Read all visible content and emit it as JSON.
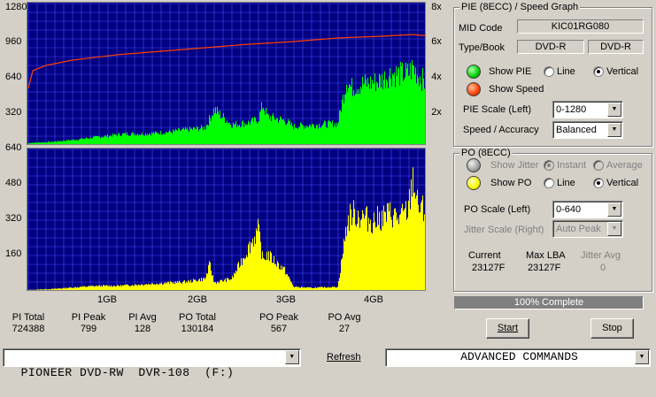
{
  "colors": {
    "graph_bg": "#000080",
    "grid": "#4a4aff",
    "pie": "#00ff00",
    "po": "#ffff00",
    "speed": "#ff4000",
    "cursor": "#ff4000",
    "progress": "#808080"
  },
  "pie_graph": {
    "left_ticks": [
      "1280",
      "960",
      "640",
      "320"
    ],
    "right_ticks": [
      "8x",
      "6x",
      "4x",
      "2x"
    ]
  },
  "po_graph": {
    "left_ticks": [
      "640",
      "480",
      "320",
      "160"
    ]
  },
  "x_axis_labels": [
    "1GB",
    "2GB",
    "3GB",
    "4GB"
  ],
  "chart_data": [
    {
      "type": "area",
      "title": "PIE (8ECC)",
      "x_unit": "GB",
      "xlim": [
        0,
        4.5
      ],
      "ylim": [
        0,
        1280
      ],
      "y2lim": [
        0,
        8
      ],
      "series": [
        {
          "name": "PIE",
          "x": [
            0.0,
            0.25,
            0.5,
            0.7,
            0.9,
            1.1,
            1.3,
            1.5,
            1.7,
            1.9,
            2.0,
            2.1,
            2.3,
            2.5,
            2.6,
            2.65,
            2.7,
            2.8,
            2.9,
            3.0,
            3.1,
            3.3,
            3.5,
            3.6,
            3.65,
            3.7,
            3.8,
            3.9,
            4.0,
            4.1,
            4.2,
            4.3,
            4.35,
            4.4,
            4.45,
            4.5
          ],
          "values": [
            20,
            30,
            50,
            70,
            90,
            110,
            110,
            120,
            140,
            160,
            170,
            350,
            200,
            220,
            250,
            400,
            280,
            260,
            240,
            180,
            190,
            200,
            210,
            640,
            560,
            580,
            600,
            610,
            640,
            700,
            690,
            700,
            760,
            700,
            650,
            580
          ]
        },
        {
          "name": "Speed",
          "x": [
            0.0,
            0.05,
            0.2,
            0.5,
            1.0,
            1.5,
            2.0,
            2.5,
            3.0,
            3.5,
            4.0,
            4.35,
            4.45,
            4.5
          ],
          "values": [
            3.2,
            4.2,
            4.5,
            4.8,
            5.1,
            5.3,
            5.5,
            5.7,
            5.85,
            6.05,
            6.15,
            6.25,
            6.2,
            6.2
          ]
        }
      ]
    },
    {
      "type": "area",
      "title": "PO (8ECC)",
      "x_unit": "GB",
      "xlim": [
        0,
        4.5
      ],
      "ylim": [
        0,
        640
      ],
      "series": [
        {
          "name": "PO",
          "x": [
            0.0,
            0.3,
            0.6,
            0.8,
            1.0,
            1.2,
            1.4,
            1.6,
            1.8,
            2.0,
            2.05,
            2.1,
            2.3,
            2.6,
            2.65,
            2.7,
            2.8,
            2.9,
            3.0,
            3.2,
            3.5,
            3.6,
            3.65,
            3.8,
            3.9,
            4.0,
            4.1,
            4.2,
            4.3,
            4.35,
            4.4,
            4.5
          ],
          "values": [
            5,
            10,
            20,
            25,
            25,
            30,
            35,
            40,
            45,
            60,
            130,
            40,
            60,
            300,
            150,
            180,
            140,
            100,
            20,
            15,
            20,
            320,
            380,
            360,
            340,
            360,
            380,
            350,
            400,
            567,
            420,
            380
          ]
        }
      ]
    }
  ],
  "panel_pie": {
    "title": "PIE (8ECC) / Speed Graph",
    "mid_label": "MID Code",
    "mid_value": "KIC01RG080",
    "type_label": "Type/Book",
    "type_value": "DVD-R",
    "book_value": "DVD-R",
    "show_pie": "Show PIE",
    "line": "Line",
    "vertical": "Vertical",
    "show_speed": "Show Speed",
    "scale_label": "PIE Scale (Left)",
    "scale_value": "0-1280",
    "accuracy_label": "Speed / Accuracy",
    "accuracy_value": "Balanced"
  },
  "panel_po": {
    "title": "PO (8ECC)",
    "show_jitter": "Show Jitter",
    "instant": "Instant",
    "average": "Average",
    "show_po": "Show PO",
    "line": "Line",
    "vertical": "Vertical",
    "scale_label": "PO Scale (Left)",
    "scale_value": "0-640",
    "jitter_scale_label": "Jitter Scale (Right)",
    "jitter_scale_value": "Auto Peak",
    "current_label": "Current",
    "current_value": "23127F",
    "maxlba_label": "Max LBA",
    "maxlba_value": "23127F",
    "jitteravg_label": "Jitter Avg",
    "jitteravg_value": "0"
  },
  "progress": {
    "text": "100% Complete",
    "fraction": 1.0
  },
  "stats": [
    {
      "label": "PI Total",
      "value": "724388"
    },
    {
      "label": "PI Peak",
      "value": "799"
    },
    {
      "label": "PI Avg",
      "value": "128"
    },
    {
      "label": "PO Total",
      "value": "130184"
    },
    {
      "label": "PO Peak",
      "value": "567"
    },
    {
      "label": "PO Avg",
      "value": "27"
    }
  ],
  "buttons": {
    "start": "Start",
    "stop": "Stop",
    "refresh": "Refresh"
  },
  "drive": "PIONEER DVD-RW  DVR-108  (F:)",
  "advanced": "ADVANCED COMMANDS",
  "icons": {
    "dropdown": "chevron-down-icon",
    "pie_ball": "green-ball-icon",
    "speed_ball": "red-ball-icon",
    "po_ball": "yellow-ball-icon",
    "jitter_ball": "gray-ball-icon"
  }
}
